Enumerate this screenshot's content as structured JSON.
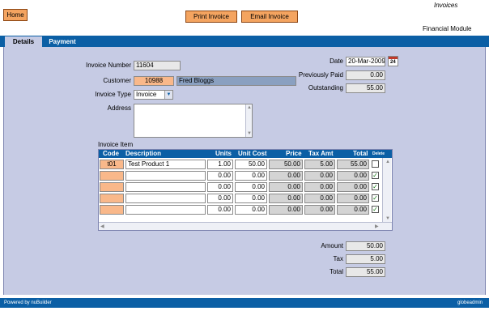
{
  "header": {
    "home_label": "Home",
    "print_label": "Print Invoice",
    "email_label": "Email Invoice",
    "page_title": "Invoices",
    "module_title": "Financial Module"
  },
  "tabs": [
    {
      "label": "Details",
      "active": true
    },
    {
      "label": "Payment",
      "active": false
    }
  ],
  "form": {
    "invoice_number_label": "Invoice Number",
    "invoice_number": "11604",
    "customer_label": "Customer",
    "customer_code": "10988",
    "customer_name": "Fred Bloggs",
    "invoice_type_label": "Invoice Type",
    "invoice_type": "Invoice",
    "address_label": "Address",
    "address": "",
    "date_label": "Date",
    "date": "20-Mar-2009",
    "previously_paid_label": "Previously Paid",
    "previously_paid": "0.00",
    "outstanding_label": "Outstanding",
    "outstanding": "55.00"
  },
  "invoice_items": {
    "title": "Invoice Item",
    "columns": [
      "Code",
      "Description",
      "Units",
      "Unit Cost",
      "Price",
      "Tax Amt",
      "Total",
      "Delete"
    ],
    "rows": [
      {
        "code": "t01",
        "description": "Test Product 1",
        "units": "1.00",
        "unit_cost": "50.00",
        "price": "50.00",
        "tax_amt": "5.00",
        "total": "55.00",
        "delete": false
      },
      {
        "code": "",
        "description": "",
        "units": "0.00",
        "unit_cost": "0.00",
        "price": "0.00",
        "tax_amt": "0.00",
        "total": "0.00",
        "delete": true
      },
      {
        "code": "",
        "description": "",
        "units": "0.00",
        "unit_cost": "0.00",
        "price": "0.00",
        "tax_amt": "0.00",
        "total": "0.00",
        "delete": true
      },
      {
        "code": "",
        "description": "",
        "units": "0.00",
        "unit_cost": "0.00",
        "price": "0.00",
        "tax_amt": "0.00",
        "total": "0.00",
        "delete": true
      },
      {
        "code": "",
        "description": "",
        "units": "0.00",
        "unit_cost": "0.00",
        "price": "0.00",
        "tax_amt": "0.00",
        "total": "0.00",
        "delete": true
      }
    ]
  },
  "totals": {
    "amount_label": "Amount",
    "amount": "50.00",
    "tax_label": "Tax",
    "tax": "5.00",
    "total_label": "Total",
    "total": "55.00"
  },
  "footer": {
    "powered_by": "Powered by nuBuilder",
    "user": "globeadmin"
  },
  "icons": {
    "calendar": "calendar-icon",
    "dropdown": "chevron-down-icon",
    "checkbox": "checkbox-icon"
  },
  "colors": {
    "accent_blue": "#0b5fa5",
    "content_bg": "#c6cbe4",
    "orange": "#f4a460"
  }
}
